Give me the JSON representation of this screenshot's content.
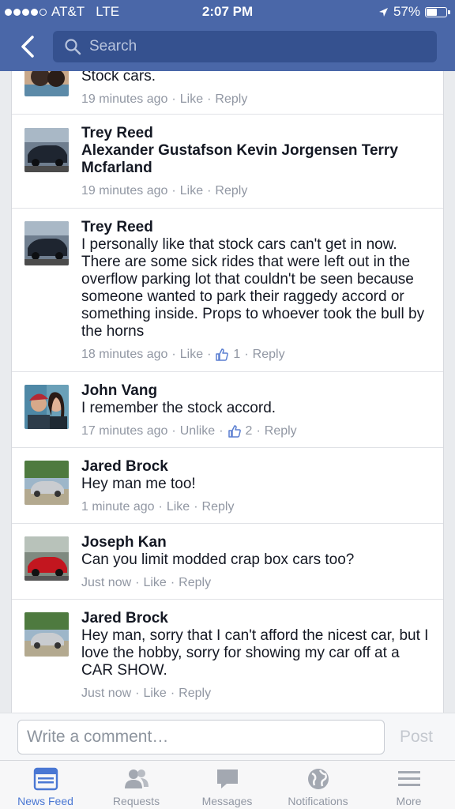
{
  "status_bar": {
    "carrier": "AT&T",
    "network": "LTE",
    "time": "2:07 PM",
    "battery": "57%",
    "battery_level": 0.57
  },
  "nav": {
    "search_placeholder": "Search"
  },
  "comments": [
    {
      "name": "",
      "text": "Stock cars.",
      "time": "19 minutes ago",
      "like": "Like",
      "reply": "Reply",
      "likes": ""
    },
    {
      "name": "Trey Reed",
      "text": "Alexander Gustafson Kevin Jorgensen Terry Mcfarland",
      "time": "19 minutes ago",
      "like": "Like",
      "reply": "Reply",
      "likes": ""
    },
    {
      "name": "Trey Reed",
      "text": "I personally like that stock cars can't get in now. There are some sick rides that were left out in the overflow parking lot that couldn't be seen because someone wanted to park their raggedy accord or something inside. Props to whoever took the bull by the horns",
      "time": "18 minutes ago",
      "like": "Like",
      "reply": "Reply",
      "likes": "1"
    },
    {
      "name": "John Vang",
      "text": "I remember the stock accord.",
      "time": "17 minutes ago",
      "like": "Unlike",
      "reply": "Reply",
      "likes": "2"
    },
    {
      "name": "Jared Brock",
      "text": "Hey man me too!",
      "time": "1 minute ago",
      "like": "Like",
      "reply": "Reply",
      "likes": ""
    },
    {
      "name": "Joseph Kan",
      "text": "Can you limit modded crap box cars too?",
      "time": "Just now",
      "like": "Like",
      "reply": "Reply",
      "likes": ""
    },
    {
      "name": "Jared Brock",
      "text": "Hey man, sorry that I can't afford the nicest car, but I love the hobby, sorry for showing my car off at a CAR SHOW.",
      "time": "Just now",
      "like": "Like",
      "reply": "Reply",
      "likes": ""
    }
  ],
  "composer": {
    "placeholder": "Write a comment…",
    "post_label": "Post"
  },
  "tabs": [
    {
      "label": "News Feed",
      "icon": "news-feed-icon",
      "active": true
    },
    {
      "label": "Requests",
      "icon": "requests-icon",
      "active": false
    },
    {
      "label": "Messages",
      "icon": "messages-icon",
      "active": false
    },
    {
      "label": "Notifications",
      "icon": "notifications-icon",
      "active": false
    },
    {
      "label": "More",
      "icon": "more-icon",
      "active": false
    }
  ],
  "colors": {
    "brand": "#4a67a8",
    "active_tab": "#4a77d3",
    "meta_text": "#9197a3"
  }
}
